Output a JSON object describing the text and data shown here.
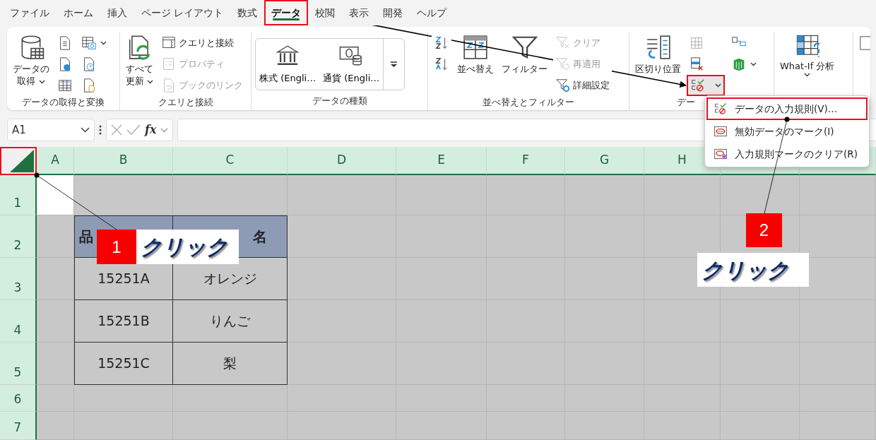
{
  "menu_tabs": [
    {
      "label": "ファイル",
      "selected": false,
      "highlighted": false
    },
    {
      "label": "ホーム",
      "selected": false,
      "highlighted": false
    },
    {
      "label": "挿入",
      "selected": false,
      "highlighted": false
    },
    {
      "label": "ページ レイアウト",
      "selected": false,
      "highlighted": false
    },
    {
      "label": "数式",
      "selected": false,
      "highlighted": false
    },
    {
      "label": "データ",
      "selected": true,
      "highlighted": true
    },
    {
      "label": "校閲",
      "selected": false,
      "highlighted": false
    },
    {
      "label": "表示",
      "selected": false,
      "highlighted": false
    },
    {
      "label": "開発",
      "selected": false,
      "highlighted": false
    },
    {
      "label": "ヘルプ",
      "selected": false,
      "highlighted": false
    }
  ],
  "ribbon_groups": [
    {
      "label": "データの取得と変換",
      "items": [
        {
          "kind": "large",
          "lines": [
            "データの",
            "取得"
          ],
          "dropdown": true
        },
        {
          "kind": "icon"
        },
        {
          "kind": "icon"
        },
        {
          "kind": "icon"
        },
        {
          "kind": "icon",
          "dropdown": true
        },
        {
          "kind": "icon"
        },
        {
          "kind": "icon"
        }
      ]
    },
    {
      "label": "クエリと接続",
      "items": [
        {
          "kind": "large",
          "lines": [
            "すべて",
            "更新"
          ],
          "dropdown": true
        },
        {
          "kind": "small",
          "label": "クエリと接続",
          "disabled": false
        },
        {
          "kind": "small",
          "label": "プロパティ",
          "disabled": true
        },
        {
          "kind": "small",
          "label": "ブックのリンク",
          "disabled": true
        }
      ]
    },
    {
      "label": "データの種類",
      "items": [
        {
          "kind": "gallery",
          "label": "株式 (Engli…"
        },
        {
          "kind": "gallery",
          "label": "通貨 (Engli…"
        },
        {
          "kind": "more"
        }
      ]
    },
    {
      "label": "並べ替えとフィルター",
      "items": [
        {
          "kind": "icon"
        },
        {
          "kind": "icon"
        },
        {
          "kind": "large",
          "lines": [
            "並べ替え"
          ]
        },
        {
          "kind": "large",
          "lines": [
            "フィルター"
          ]
        },
        {
          "kind": "small",
          "label": "クリア",
          "disabled": true
        },
        {
          "kind": "small",
          "label": "再適用",
          "disabled": true
        },
        {
          "kind": "small",
          "label": "詳細設定",
          "disabled": false
        }
      ]
    },
    {
      "label": "デー",
      "items": [
        {
          "kind": "large",
          "lines": [
            "区切り位置"
          ]
        },
        {
          "kind": "icon"
        },
        {
          "kind": "icon"
        },
        {
          "kind": "icon",
          "dropdown": true,
          "highlighted": true
        },
        {
          "kind": "icon"
        },
        {
          "kind": "icon",
          "dropdown": true
        }
      ]
    },
    {
      "items": [
        {
          "kind": "large",
          "lines": [
            "What-If 分析"
          ],
          "dropdown": true
        }
      ]
    },
    {
      "items": [
        {
          "kind": "icon"
        }
      ]
    }
  ],
  "formula_bar": {
    "name_box": "A1",
    "function_label": "fx"
  },
  "sheet": {
    "dimmed": true,
    "columns": [
      "A",
      "B",
      "C",
      "D",
      "E",
      "F",
      "G",
      "H"
    ],
    "rows": [
      "1",
      "2",
      "3",
      "4",
      "5",
      "6",
      "7"
    ],
    "select_all_highlighted": true,
    "table": {
      "header": [
        "品",
        "名"
      ],
      "rows": [
        [
          "15251A",
          "オレンジ"
        ],
        [
          "15251B",
          "りんご"
        ],
        [
          "15251C",
          "梨"
        ]
      ]
    }
  },
  "dropdown_menu": {
    "items": [
      {
        "label": "データの入力規則(V)…",
        "highlighted": true
      },
      {
        "label": "無効データのマーク(I)",
        "highlighted": false
      },
      {
        "label": "入力規則マークのクリア(R)",
        "highlighted": false
      }
    ]
  },
  "callouts": [
    {
      "number": "1",
      "text": "クリック"
    },
    {
      "number": "2",
      "text": "クリック"
    }
  ]
}
